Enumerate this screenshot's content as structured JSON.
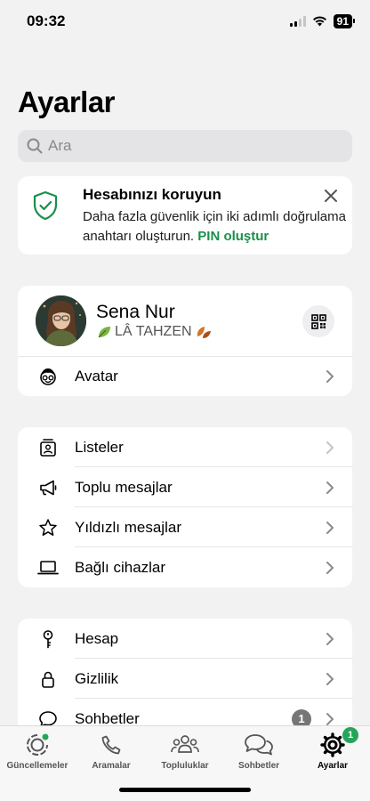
{
  "status_bar": {
    "time": "09:32",
    "battery": "91"
  },
  "page_title": "Ayarlar",
  "search": {
    "placeholder": "Ara"
  },
  "security_banner": {
    "title": "Hesabınızı koruyun",
    "body": "Daha fazla güvenlik için iki adımlı doğrulama anahtarı oluşturun.",
    "link": "PIN oluştur",
    "accent_color": "#1a8f4a"
  },
  "profile": {
    "name": "Sena Nur",
    "status": "LÂ TAHZEN",
    "status_prefix_icon": "leaf-icon",
    "status_suffix_icon": "autumn-leaves-icon"
  },
  "profile_rows": [
    {
      "label": "Avatar",
      "icon": "avatar-face-icon"
    }
  ],
  "group1": [
    {
      "label": "Listeler",
      "icon": "lists-icon"
    },
    {
      "label": "Toplu mesajlar",
      "icon": "megaphone-icon"
    },
    {
      "label": "Yıldızlı mesajlar",
      "icon": "star-icon"
    },
    {
      "label": "Bağlı cihazlar",
      "icon": "laptop-icon"
    }
  ],
  "group2": [
    {
      "label": "Hesap",
      "icon": "key-icon"
    },
    {
      "label": "Gizlilik",
      "icon": "lock-icon"
    },
    {
      "label": "Sohbetler",
      "icon": "chat-bubble-icon",
      "badge": "1"
    }
  ],
  "tabs": [
    {
      "label": "Güncellemeler",
      "icon": "updates-icon"
    },
    {
      "label": "Aramalar",
      "icon": "phone-icon"
    },
    {
      "label": "Topluluklar",
      "icon": "communities-icon"
    },
    {
      "label": "Sohbetler",
      "icon": "chats-icon"
    },
    {
      "label": "Ayarlar",
      "icon": "settings-gear-icon",
      "badge": "1",
      "active": true
    }
  ]
}
